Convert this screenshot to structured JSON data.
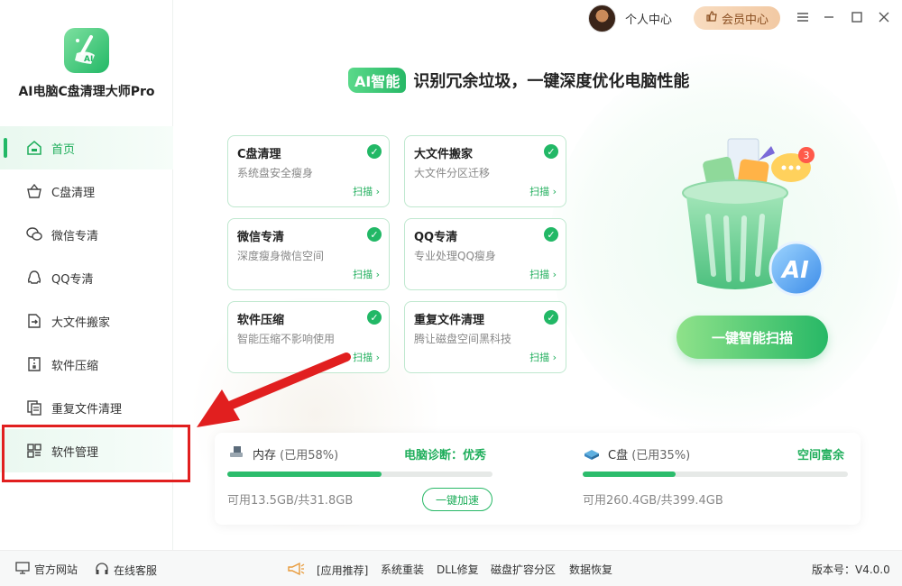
{
  "app": {
    "name": "AI电脑C盘清理大师Pro"
  },
  "sidebar": {
    "items": [
      {
        "label": "首页",
        "icon": "home-icon"
      },
      {
        "label": "C盘清理",
        "icon": "basket-icon"
      },
      {
        "label": "微信专清",
        "icon": "wechat-icon"
      },
      {
        "label": "QQ专清",
        "icon": "qq-icon"
      },
      {
        "label": "大文件搬家",
        "icon": "file-move-icon"
      },
      {
        "label": "软件压缩",
        "icon": "zip-icon"
      },
      {
        "label": "重复文件清理",
        "icon": "duplicate-icon"
      },
      {
        "label": "软件管理",
        "icon": "grid-icon"
      }
    ]
  },
  "topbar": {
    "personal_center": "个人中心",
    "vip_center": "会员中心"
  },
  "headline": {
    "tag": "AI智能",
    "text": "识别冗余垃圾，一键深度优化电脑性能"
  },
  "cards": [
    {
      "title": "C盘清理",
      "desc": "系统盘安全瘦身",
      "action": "扫描 ›"
    },
    {
      "title": "大文件搬家",
      "desc": "大文件分区迁移",
      "action": "扫描 ›"
    },
    {
      "title": "微信专清",
      "desc": "深度瘦身微信空间",
      "action": "扫描 ›"
    },
    {
      "title": "QQ专清",
      "desc": "专业处理QQ瘦身",
      "action": "扫描 ›"
    },
    {
      "title": "软件压缩",
      "desc": "智能压缩不影响使用",
      "action": "扫描 ›"
    },
    {
      "title": "重复文件清理",
      "desc": "腾让磁盘空间黑科技",
      "action": "扫描 ›"
    }
  ],
  "scan_button": "一键智能扫描",
  "trash_badge": "3",
  "ai_badge": "AI",
  "memory": {
    "label": "内存",
    "usage_text": "(已用58%)",
    "usage_fraction": 0.58,
    "diagnosis": "电脑诊断：优秀",
    "detail": "可用13.5GB/共31.8GB",
    "button": "一键加速"
  },
  "disk": {
    "label": "C盘",
    "usage_text": "(已用35%)",
    "usage_fraction": 0.35,
    "status": "空间富余",
    "detail": "可用260.4GB/共399.4GB"
  },
  "footer": {
    "website": "官方网站",
    "support": "在线客服",
    "recommend": "[应用推荐]",
    "links": [
      "系统重装",
      "DLL修复",
      "磁盘扩容分区",
      "数据恢复"
    ],
    "version": "版本号：V4.0.0"
  },
  "colors": {
    "accent": "#22b866",
    "annotation_red": "#e11f1f"
  }
}
